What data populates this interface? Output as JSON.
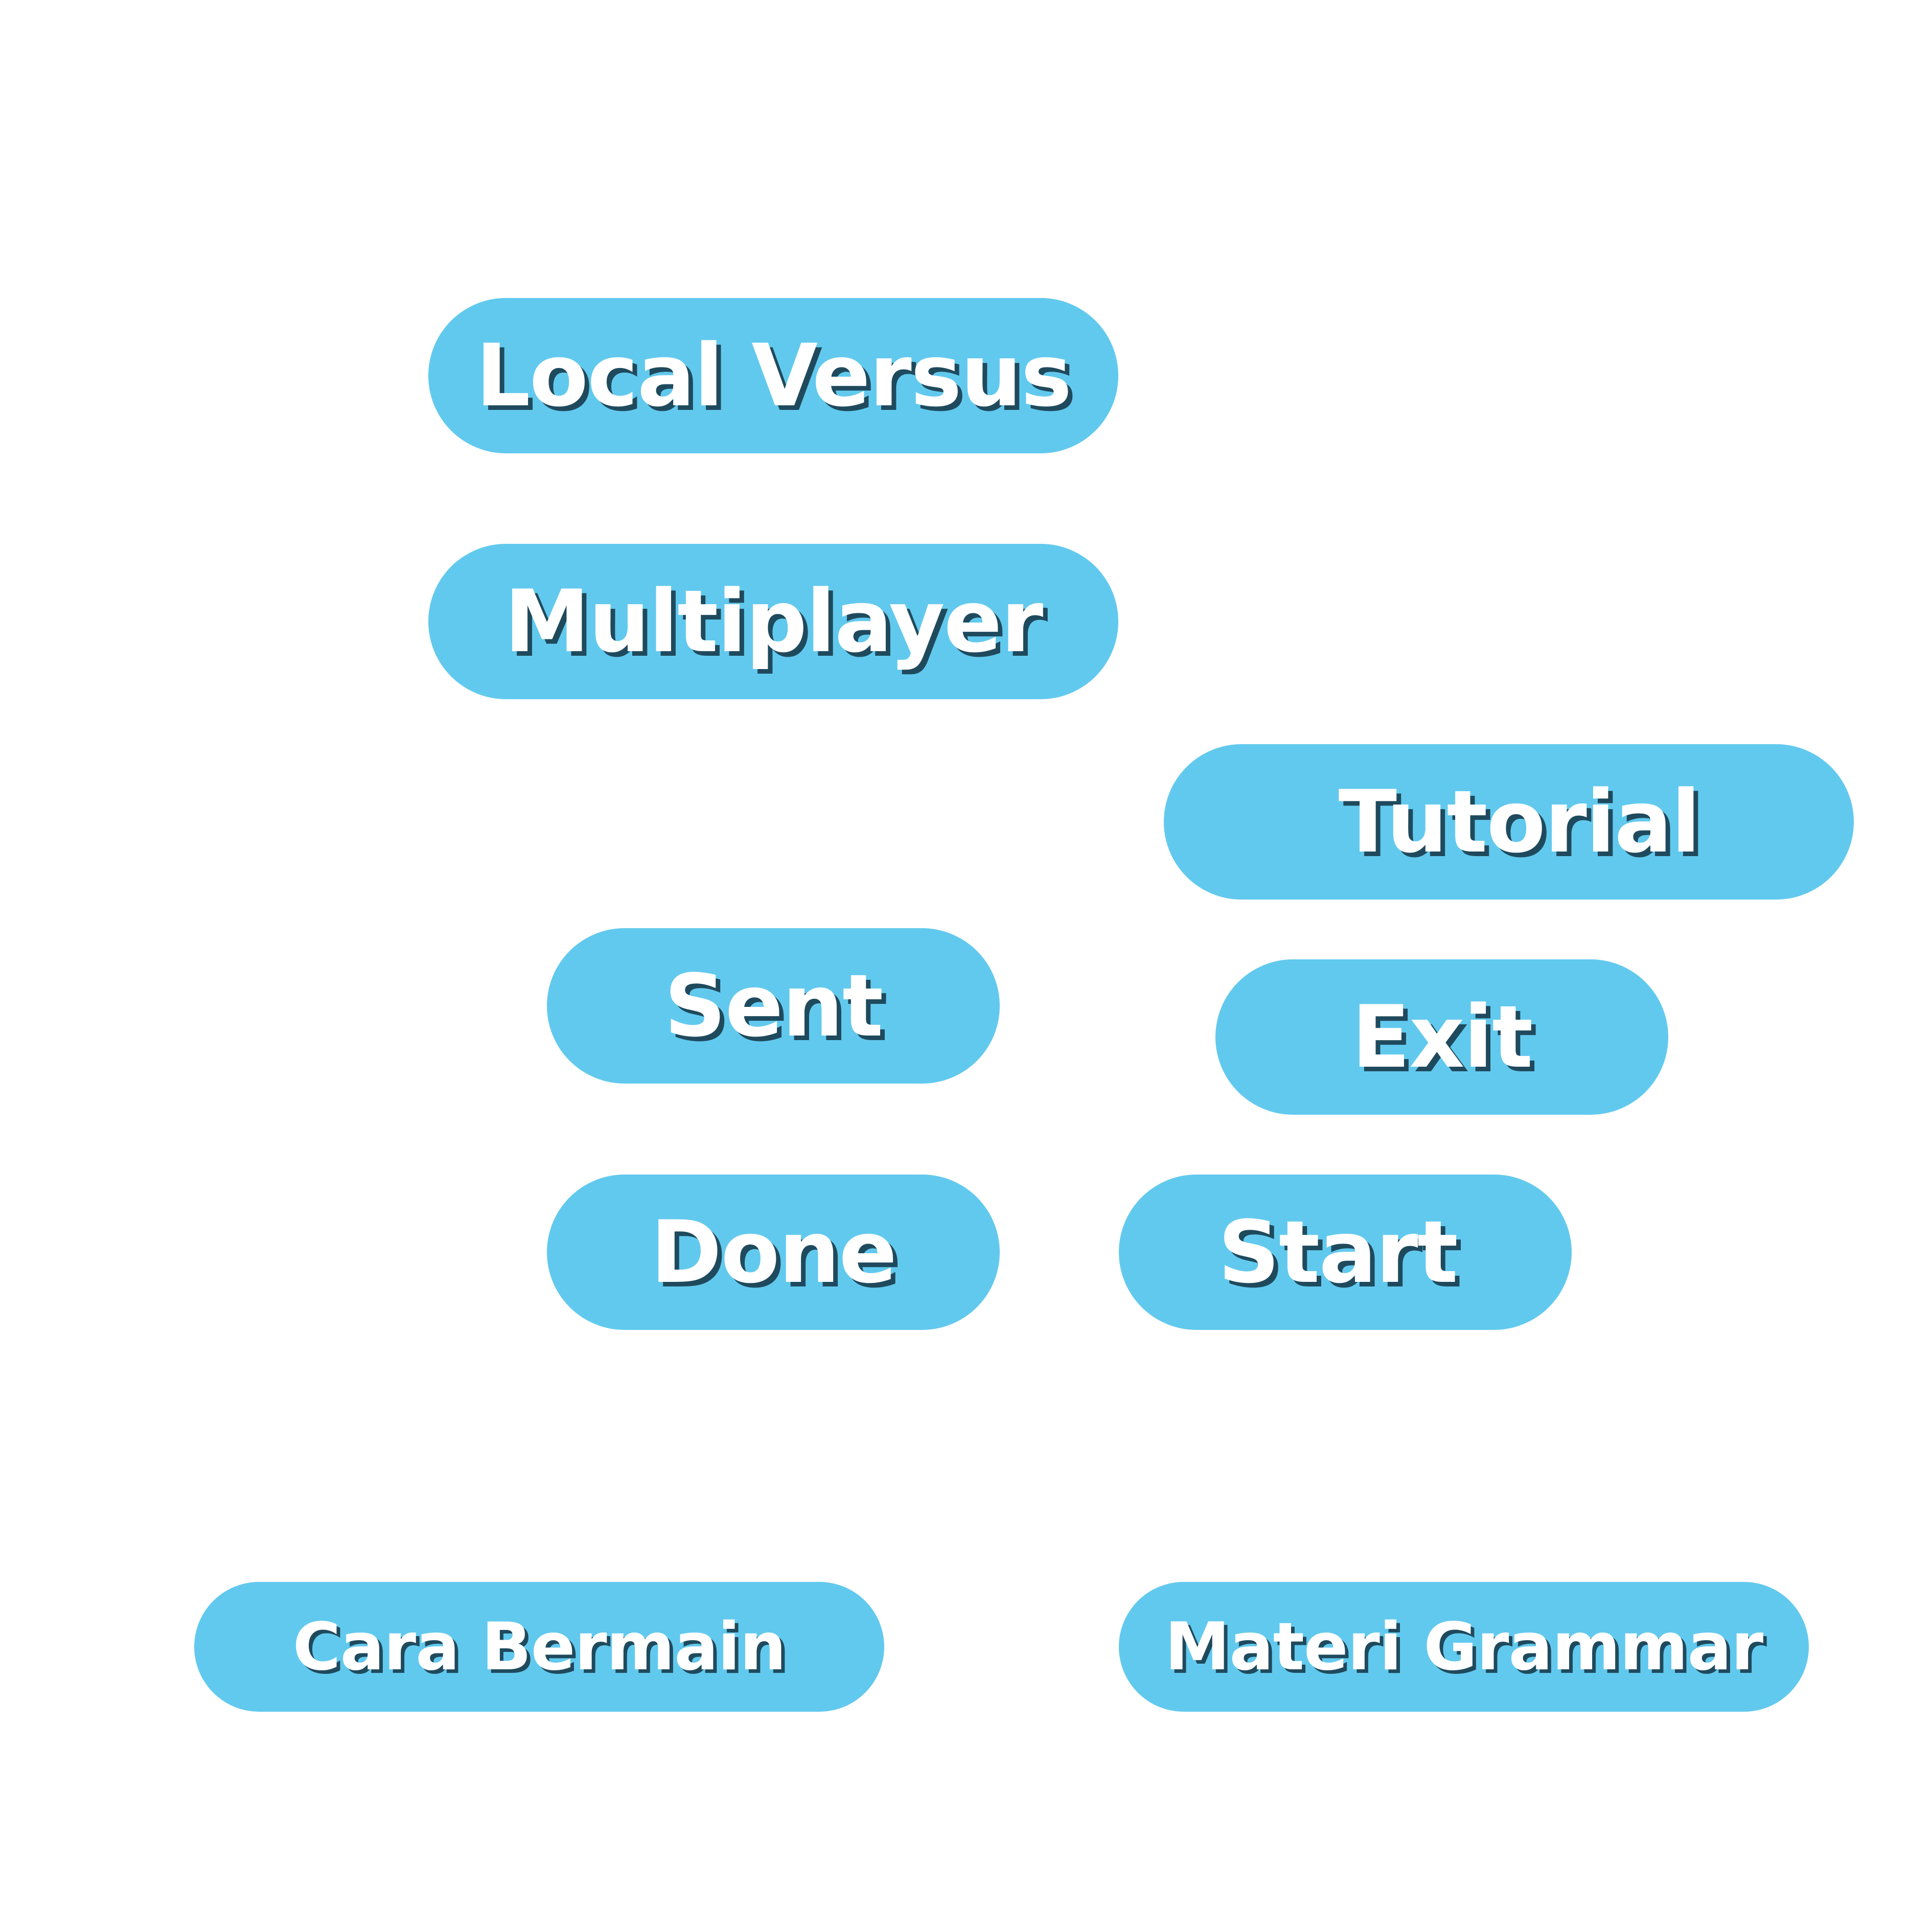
{
  "buttons": {
    "local_versus": "Local Versus",
    "multiplayer": "Multiplayer",
    "tutorial": "Tutorial",
    "sent": "Sent",
    "exit": "Exit",
    "done": "Done",
    "start": "Start",
    "cara_bermain": "Cara Bermain",
    "materi_grammar": "Materi Grammar"
  },
  "colors": {
    "button_fill": "#62c9ee",
    "label_text": "#ffffff",
    "label_shadow": "#1f4a5d",
    "background": "#ffffff"
  }
}
